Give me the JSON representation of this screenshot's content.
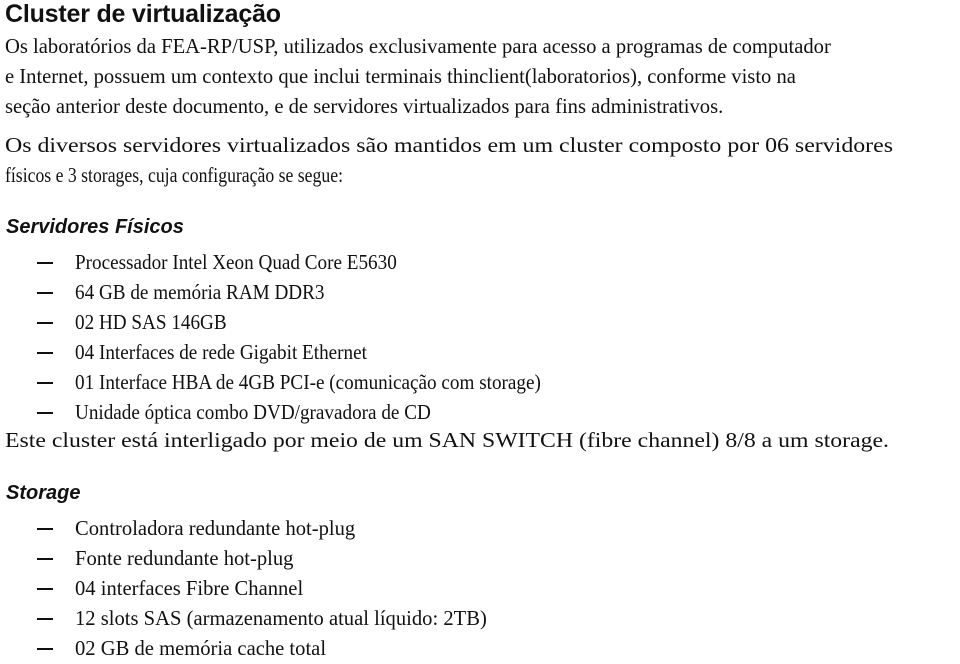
{
  "document": {
    "title": "Cluster de virtualização",
    "intro_paragraph": {
      "lines": [
        "Os laboratórios da FEA-RP/USP, utilizados exclusivamente para acesso a programas de computador",
        "e Internet, possuem um contexto que inclui terminais thinclient(laboratorios), conforme visto na",
        "seção anterior deste documento, e de servidores virtualizados para fins administrativos."
      ]
    },
    "cluster_paragraph": {
      "lines": [
        "Os diversos servidores virtualizados são mantidos em um cluster composto por 06 servidores",
        "físicos e 3 storages, cuja configuração se segue:"
      ]
    },
    "sections": [
      {
        "heading": "Servidores Físicos",
        "items": [
          "Processador Intel Xeon Quad Core E5630",
          "64 GB de memória RAM DDR3",
          "02 HD SAS 146GB",
          "04 Interfaces de rede Gigabit Ethernet",
          "01 Interface HBA de 4GB PCI-e (comunicação com storage)",
          "Unidade óptica combo DVD/gravadora de CD"
        ],
        "note": "Este cluster está interligado por meio de um SAN SWITCH (fibre channel) 8/8 a um storage."
      },
      {
        "heading": "Storage",
        "items": [
          "Controladora redundante hot-plug",
          "Fonte redundante hot-plug",
          "04 interfaces Fibre Channel",
          "12 slots SAS (armazenamento atual líquido: 2TB)",
          "02 GB de memória cache total"
        ]
      }
    ],
    "bullet_icon": "en-dash"
  }
}
